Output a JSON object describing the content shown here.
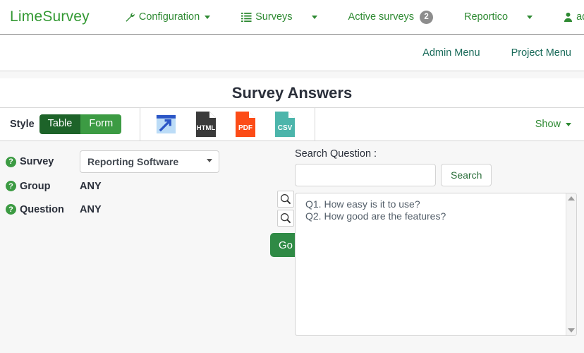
{
  "navbar": {
    "brand": "LimeSurvey",
    "items": [
      {
        "label": "Configuration",
        "icon": "wrench-icon",
        "caret": true,
        "badge": null
      },
      {
        "label": "Surveys",
        "icon": "list-icon",
        "caret": true,
        "badge": null
      },
      {
        "label": "Active surveys",
        "icon": null,
        "caret": false,
        "badge": "2"
      },
      {
        "label": "Reportico",
        "icon": null,
        "caret": true,
        "badge": null
      },
      {
        "label": "admin",
        "icon": "user-icon",
        "caret": true,
        "badge": null
      },
      {
        "label": "",
        "icon": "bell-icon",
        "caret": true,
        "badge": null
      }
    ]
  },
  "menubar": {
    "admin_menu": "Admin Menu",
    "project_menu": "Project Menu"
  },
  "page": {
    "title": "Survey Answers"
  },
  "toolbar": {
    "style_label": "Style",
    "style_table": "Table",
    "style_form": "Form",
    "icons": [
      {
        "name": "launch-window-icon",
        "label": ""
      },
      {
        "name": "html-export-icon",
        "label": "HTML"
      },
      {
        "name": "pdf-export-icon",
        "label": "PDF"
      },
      {
        "name": "csv-export-icon",
        "label": "CSV"
      }
    ],
    "show_label": "Show"
  },
  "criteria": {
    "survey": {
      "label": "Survey",
      "value": "Reporting Software",
      "options": [
        "Reporting Software"
      ]
    },
    "group": {
      "label": "Group",
      "value": "ANY"
    },
    "question": {
      "label": "Question",
      "value": "ANY"
    },
    "help_glyph": "?"
  },
  "actions": {
    "go_label": "Go",
    "magnifier_glyph": "search-icon"
  },
  "search": {
    "label": "Search Question :",
    "value": "",
    "placeholder": "",
    "button_label": "Search"
  },
  "question_list": {
    "items": [
      "Q1. How easy is it to use?",
      "Q2. How good are the features?"
    ]
  },
  "colors": {
    "brand_green": "#339933",
    "nav_green": "#2f8a33",
    "dark_green": "#1d6329",
    "mid_green": "#3c9b43",
    "go_green": "#2f8a45",
    "badge_gray": "#8d8d8d",
    "pdf_orange": "#fc4c17",
    "csv_teal": "#4cb5ab",
    "html_dark": "#3a3a3a",
    "accent_blue": "#2b56c6",
    "title_dark": "#2a2f3a",
    "page_bg": "#f7f7f7"
  }
}
